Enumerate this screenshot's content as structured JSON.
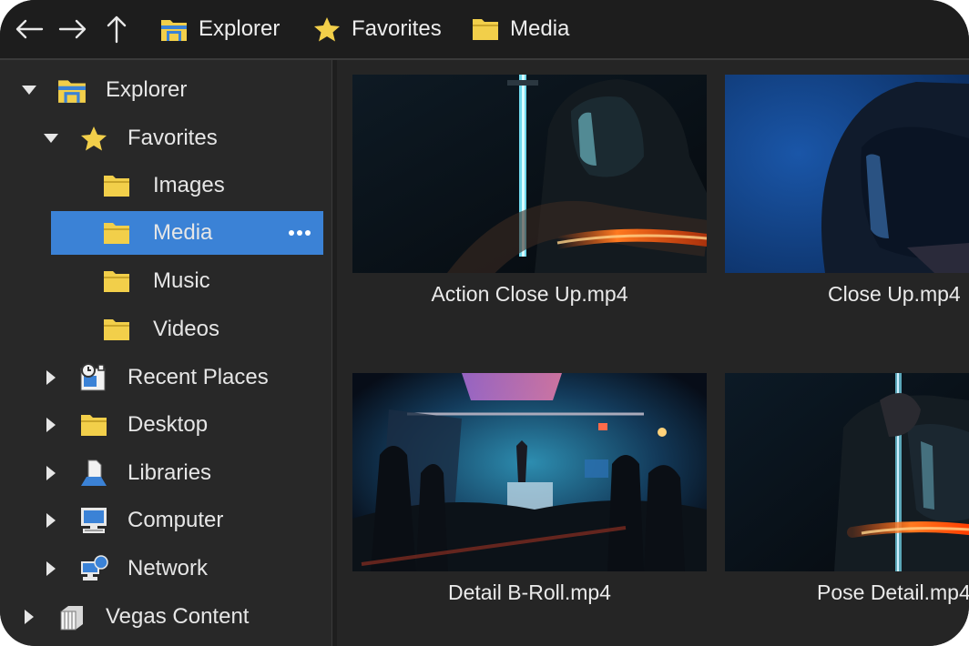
{
  "toolbar": {
    "back_icon": "arrow-left-icon",
    "forward_icon": "arrow-right-icon",
    "up_icon": "arrow-up-icon"
  },
  "breadcrumb": {
    "items": [
      {
        "label": "Explorer",
        "icon": "explorer-folder-icon"
      },
      {
        "label": "Favorites",
        "icon": "star-icon"
      },
      {
        "label": "Media",
        "icon": "folder-icon"
      }
    ]
  },
  "sidebar": {
    "items": [
      {
        "label": "Explorer",
        "icon": "explorer-folder-icon",
        "expanded": true
      },
      {
        "label": "Favorites",
        "icon": "star-icon",
        "expanded": true
      },
      {
        "label": "Images",
        "icon": "folder-icon"
      },
      {
        "label": "Media",
        "icon": "folder-icon",
        "selected": true
      },
      {
        "label": "Music",
        "icon": "folder-icon"
      },
      {
        "label": "Videos",
        "icon": "folder-icon"
      },
      {
        "label": "Recent Places",
        "icon": "recent-places-icon",
        "expanded": false
      },
      {
        "label": "Desktop",
        "icon": "folder-icon",
        "expanded": false
      },
      {
        "label": "Libraries",
        "icon": "libraries-icon",
        "expanded": false
      },
      {
        "label": "Computer",
        "icon": "computer-icon",
        "expanded": false
      },
      {
        "label": "Network",
        "icon": "network-icon",
        "expanded": false
      },
      {
        "label": "Vegas Content",
        "icon": "vegas-content-icon",
        "expanded": false
      }
    ]
  },
  "files": [
    {
      "name": "Action Close Up.mp4"
    },
    {
      "name": "Close Up.mp4"
    },
    {
      "name": "Detail B-Roll.mp4"
    },
    {
      "name": "Pose Detail.mp4"
    }
  ],
  "colors": {
    "accent": "#3b82d6",
    "folder": "#f2cf4a",
    "background": "#272727"
  }
}
